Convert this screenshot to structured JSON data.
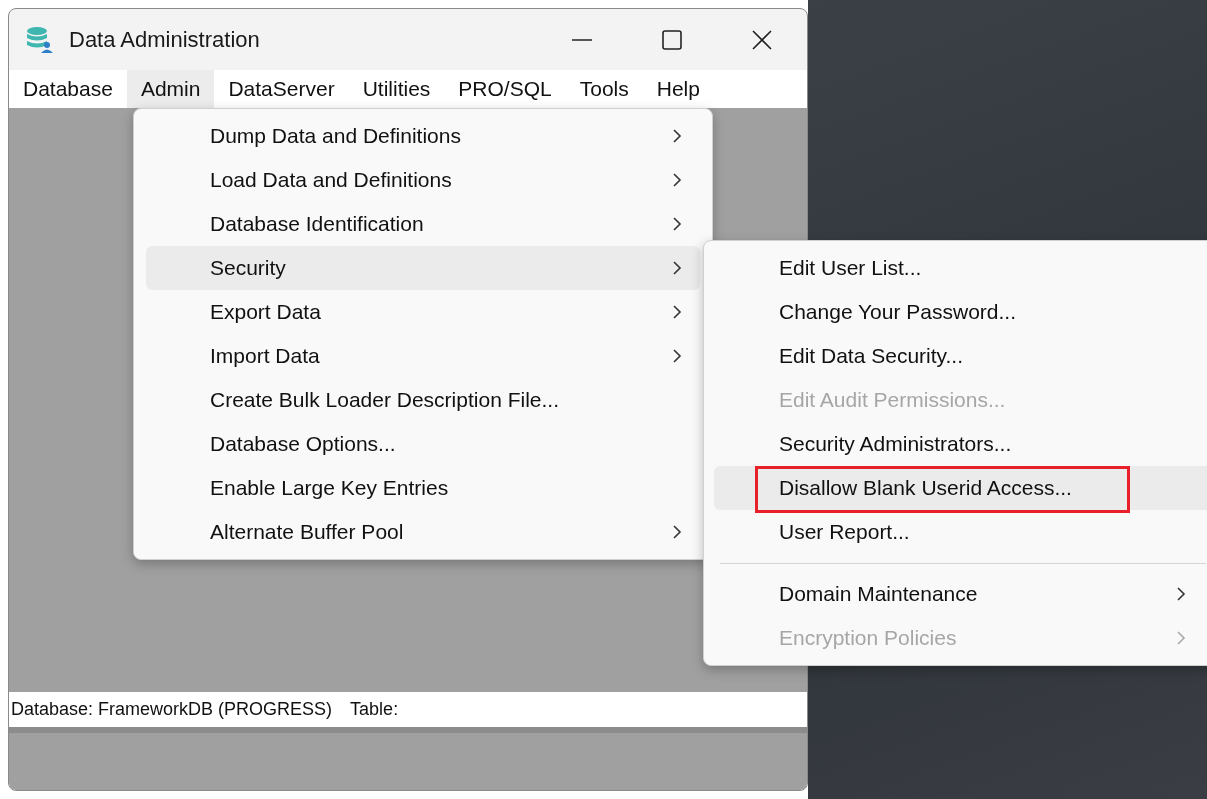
{
  "window": {
    "title": "Data Administration"
  },
  "menubar": [
    {
      "label": "Database",
      "selected": false
    },
    {
      "label": "Admin",
      "selected": true
    },
    {
      "label": "DataServer",
      "selected": false
    },
    {
      "label": "Utilities",
      "selected": false
    },
    {
      "label": "PRO/SQL",
      "selected": false
    },
    {
      "label": "Tools",
      "selected": false
    },
    {
      "label": "Help",
      "selected": false
    }
  ],
  "admin_menu": [
    {
      "kind": "item",
      "label": "Dump Data and Definitions",
      "submenu": true,
      "selected": false
    },
    {
      "kind": "item",
      "label": "Load Data and Definitions",
      "submenu": true,
      "selected": false
    },
    {
      "kind": "item",
      "label": "Database Identification",
      "submenu": true,
      "selected": false
    },
    {
      "kind": "item",
      "label": "Security",
      "submenu": true,
      "selected": true
    },
    {
      "kind": "item",
      "label": "Export Data",
      "submenu": true,
      "selected": false
    },
    {
      "kind": "item",
      "label": "Import Data",
      "submenu": true,
      "selected": false
    },
    {
      "kind": "item",
      "label": "Create Bulk Loader Description File...",
      "submenu": false,
      "selected": false
    },
    {
      "kind": "item",
      "label": "Database Options...",
      "submenu": false,
      "selected": false
    },
    {
      "kind": "item",
      "label": "Enable Large Key Entries",
      "submenu": false,
      "selected": false
    },
    {
      "kind": "item",
      "label": "Alternate Buffer Pool",
      "submenu": true,
      "selected": false
    }
  ],
  "security_menu": [
    {
      "kind": "item",
      "label": "Edit User List...",
      "submenu": false,
      "disabled": false,
      "selected": false,
      "outlined": false
    },
    {
      "kind": "item",
      "label": "Change Your Password...",
      "submenu": false,
      "disabled": false,
      "selected": false,
      "outlined": false
    },
    {
      "kind": "item",
      "label": "Edit Data Security...",
      "submenu": false,
      "disabled": false,
      "selected": false,
      "outlined": false
    },
    {
      "kind": "item",
      "label": "Edit Audit Permissions...",
      "submenu": false,
      "disabled": true,
      "selected": false,
      "outlined": false
    },
    {
      "kind": "item",
      "label": "Security Administrators...",
      "submenu": false,
      "disabled": false,
      "selected": false,
      "outlined": false
    },
    {
      "kind": "item",
      "label": "Disallow Blank Userid Access...",
      "submenu": false,
      "disabled": false,
      "selected": true,
      "outlined": true
    },
    {
      "kind": "item",
      "label": "User Report...",
      "submenu": false,
      "disabled": false,
      "selected": false,
      "outlined": false
    },
    {
      "kind": "separator"
    },
    {
      "kind": "item",
      "label": "Domain Maintenance",
      "submenu": true,
      "disabled": false,
      "selected": false,
      "outlined": false
    },
    {
      "kind": "item",
      "label": "Encryption Policies",
      "submenu": true,
      "disabled": true,
      "selected": false,
      "outlined": false
    }
  ],
  "status_bar": {
    "database": "Database: FrameworkDB (PROGRESS)",
    "table": "Table:"
  }
}
